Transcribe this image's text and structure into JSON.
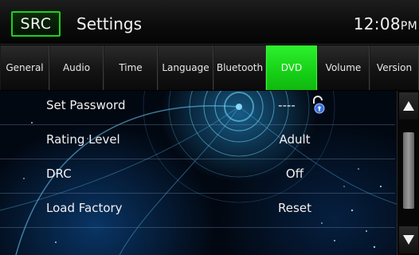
{
  "header": {
    "src_label": "SRC",
    "title": "Settings",
    "time": "12:08",
    "ampm": "PM"
  },
  "tabs": [
    {
      "label": "General",
      "active": false
    },
    {
      "label": "Audio",
      "active": false
    },
    {
      "label": "Time",
      "active": false
    },
    {
      "label": "Language",
      "active": false
    },
    {
      "label": "Bluetooth",
      "active": false
    },
    {
      "label": "DVD",
      "active": true
    },
    {
      "label": "Volume",
      "active": false
    },
    {
      "label": "Version",
      "active": false
    }
  ],
  "settings": [
    {
      "label": "Set Password",
      "value": "----"
    },
    {
      "label": "Rating Level",
      "value": "Adult"
    },
    {
      "label": "DRC",
      "value": "Off"
    },
    {
      "label": "Load Factory",
      "value": "Reset"
    }
  ],
  "icons": {
    "lock": "lock-icon",
    "scroll_up": "arrow-up-icon",
    "scroll_down": "arrow-down-icon"
  },
  "colors": {
    "accent_green": "#19d419",
    "active_tab": "#16d016",
    "background_blue": "#0f5aaa"
  }
}
